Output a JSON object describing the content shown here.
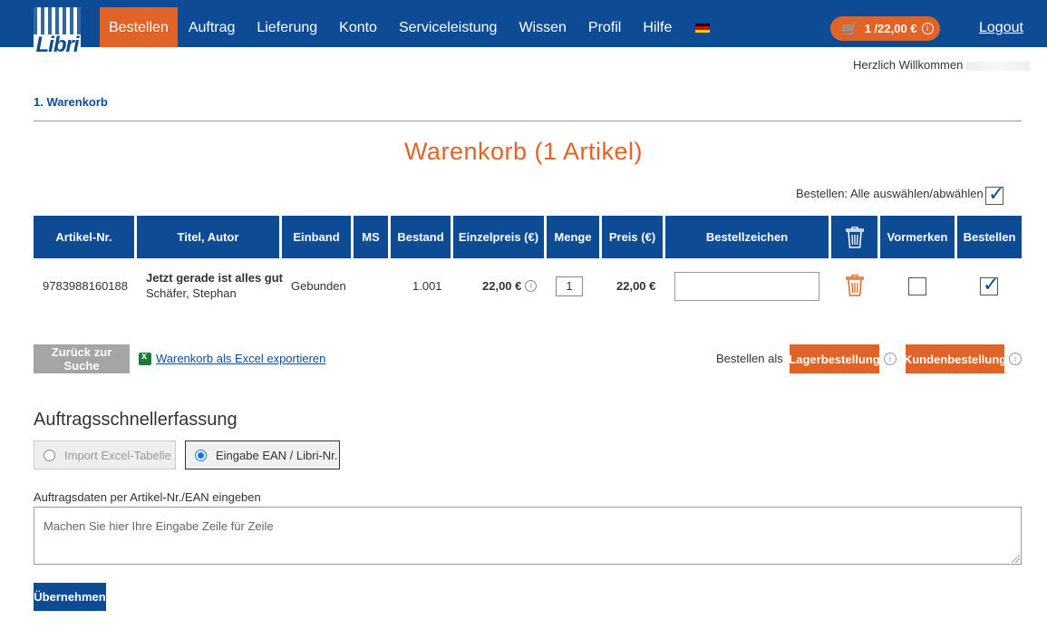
{
  "header": {
    "logo_text": "Libri",
    "nav": [
      "Bestellen",
      "Auftrag",
      "Lieferung",
      "Konto",
      "Serviceleistung",
      "Wissen",
      "Profil",
      "Hilfe"
    ],
    "active_nav": "Bestellen",
    "cart_summary": "1 /22,00 €",
    "logout": "Logout",
    "flag_colors": [
      "#000000",
      "#dd0000",
      "#ffce00"
    ]
  },
  "welcome": "Herzlich Willkommen",
  "breadcrumb": "1. Warenkorb",
  "cart": {
    "title": "Warenkorb (1 Artikel)",
    "select_all_label": "Bestellen: Alle auswählen/abwählen",
    "select_all_checked": true,
    "columns": [
      "Artikel-Nr.",
      "Titel, Autor",
      "Einband",
      "MS",
      "Bestand",
      "Einzelpreis (€)",
      "Menge",
      "Preis (€)",
      "Bestellzeichen",
      "",
      "Vormerken",
      "Bestellen"
    ],
    "rows": [
      {
        "article_no": "9783988160188",
        "title": "Jetzt gerade ist alles gut",
        "author": "Schäfer, Stephan",
        "binding": "Gebunden",
        "ms": "",
        "stock": "1.001",
        "unit_price": "22,00 €",
        "quantity": "1",
        "price": "22,00 €",
        "order_mark": "",
        "reserve": false,
        "order": true
      }
    ]
  },
  "actions": {
    "back_to_search": "Zurück zur Suche",
    "export_excel": "Warenkorb als Excel exportieren",
    "order_as": "Bestellen als",
    "stock_order": "Lagerbestellung",
    "customer_order": "Kundenbestellung"
  },
  "quick_entry": {
    "title": "Auftragsschnellerfassung",
    "option_excel": "Import Excel-Tabelle",
    "option_ean": "Eingabe EAN / Libri-Nr.",
    "selected": "Eingabe EAN / Libri-Nr.",
    "field_label": "Auftragsdaten per Artikel-Nr./EAN eingeben",
    "placeholder": "Machen Sie hier Ihre Eingabe Zeile für Zeile",
    "apply": "Übernehmen"
  },
  "colors": {
    "brand_blue": "#0d4c94",
    "accent_orange": "#e06427",
    "button_grey": "#a5a5a5"
  }
}
